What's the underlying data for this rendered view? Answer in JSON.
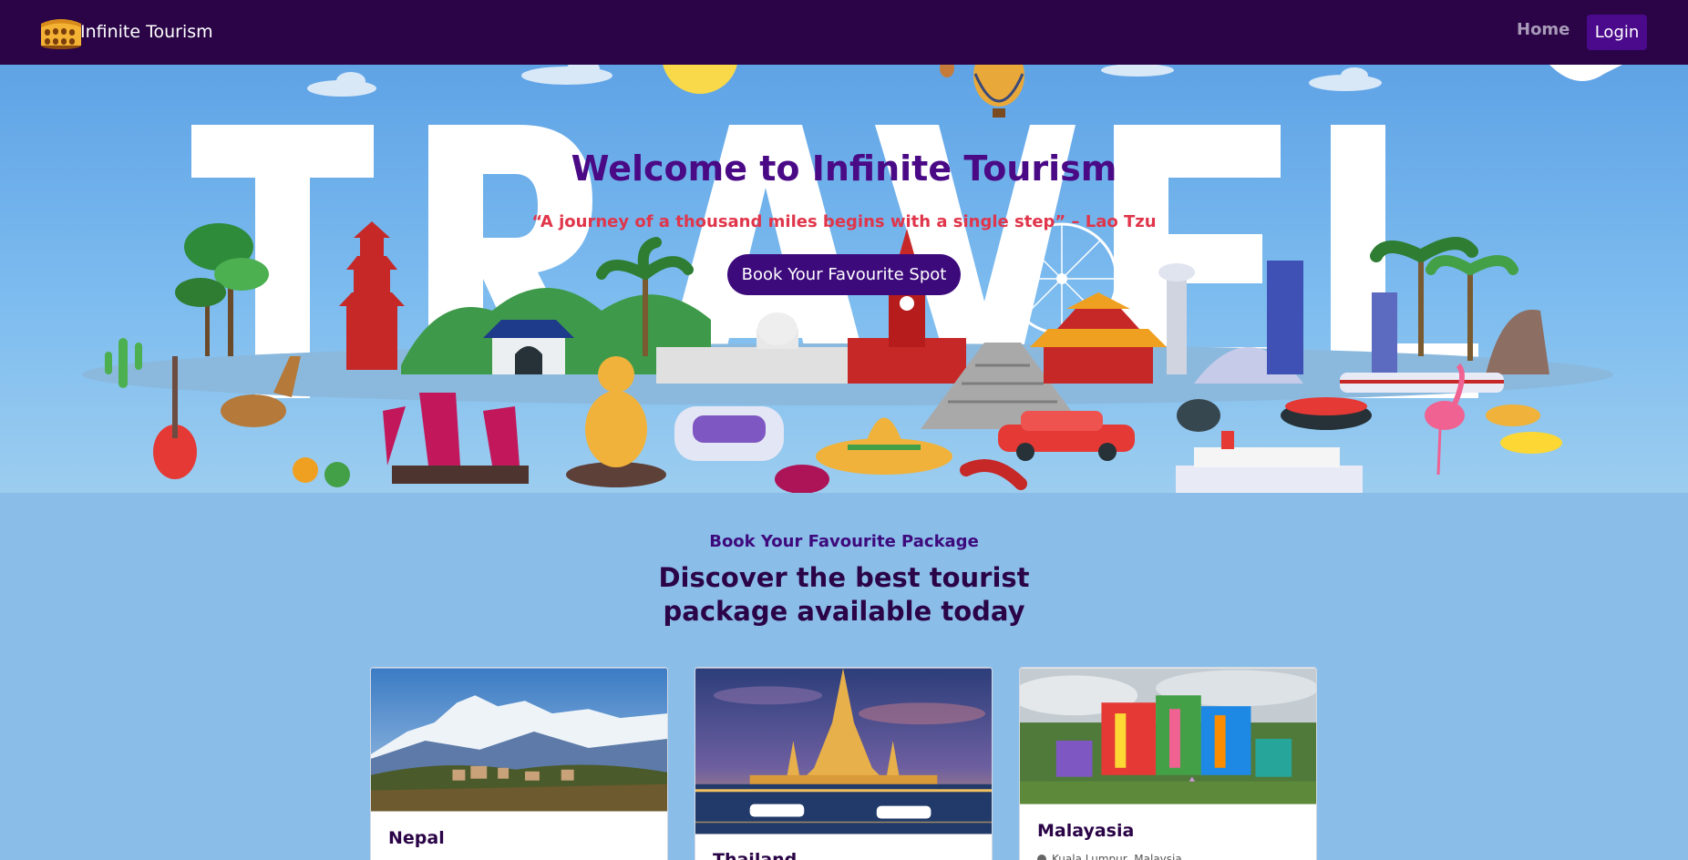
{
  "brand": {
    "name": "Infinite Tourism",
    "logo_icon": "colosseum-icon"
  },
  "nav": {
    "home": "Home",
    "login": "Login"
  },
  "hero": {
    "background_word": "TRAVEL",
    "title": "Welcome to Infinite Tourism",
    "quote": "“A journey of a thousand miles begins with a single step” – Lao Tzu",
    "cta": "Book Your Favourite Spot"
  },
  "packages": {
    "subtitle": "Book Your Favourite Package",
    "heading": "Discover the best tourist package available today",
    "cards": [
      {
        "title": "Nepal",
        "image_icon": "mountain-landscape-image"
      },
      {
        "title": "Thailand",
        "image_icon": "temple-night-image"
      },
      {
        "title": "Malayasia",
        "image_icon": "colorful-resort-image",
        "location": "Kuala Lumpur, Malaysia"
      }
    ]
  },
  "colors": {
    "navbar": "#2a0447",
    "accent": "#4b0a8c",
    "quote": "#e0354a",
    "page_bg": "#8bbde9"
  }
}
